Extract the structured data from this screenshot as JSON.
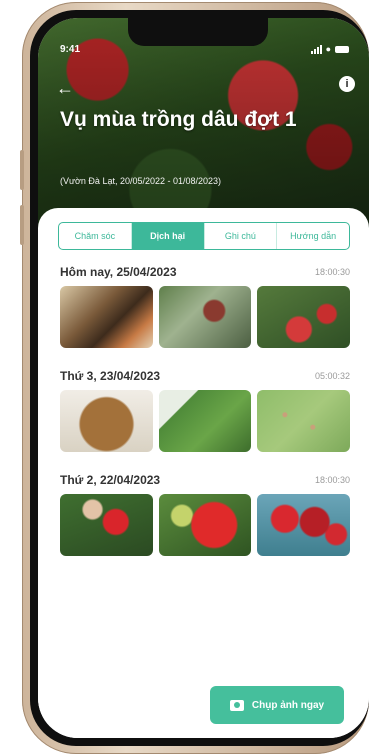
{
  "status": {
    "time": "9:41"
  },
  "header": {
    "back_icon": "arrow-left-icon",
    "info_icon": "info-icon",
    "title": "Vụ mùa trồng dâu đợt 1",
    "subtitle": "(Vườn Đà Lạt, 20/05/2022 - 01/08/2023)"
  },
  "tabs": [
    {
      "label": "Chăm sóc",
      "active": false
    },
    {
      "label": "Dịch hại",
      "active": true
    },
    {
      "label": "Ghi chú",
      "active": false
    },
    {
      "label": "Hướng dẫn",
      "active": false
    }
  ],
  "days": [
    {
      "label": "Hôm nay, 25/04/2023",
      "time": "18:00:30"
    },
    {
      "label": "Thứ 3, 23/04/2023",
      "time": "05:00:32"
    },
    {
      "label": "Thứ 2, 22/04/2023",
      "time": "18:00:30"
    }
  ],
  "capture_button": {
    "label": "Chụp ảnh ngay",
    "icon": "camera-icon"
  },
  "colors": {
    "accent": "#3db89a",
    "button": "#45bf9c"
  }
}
